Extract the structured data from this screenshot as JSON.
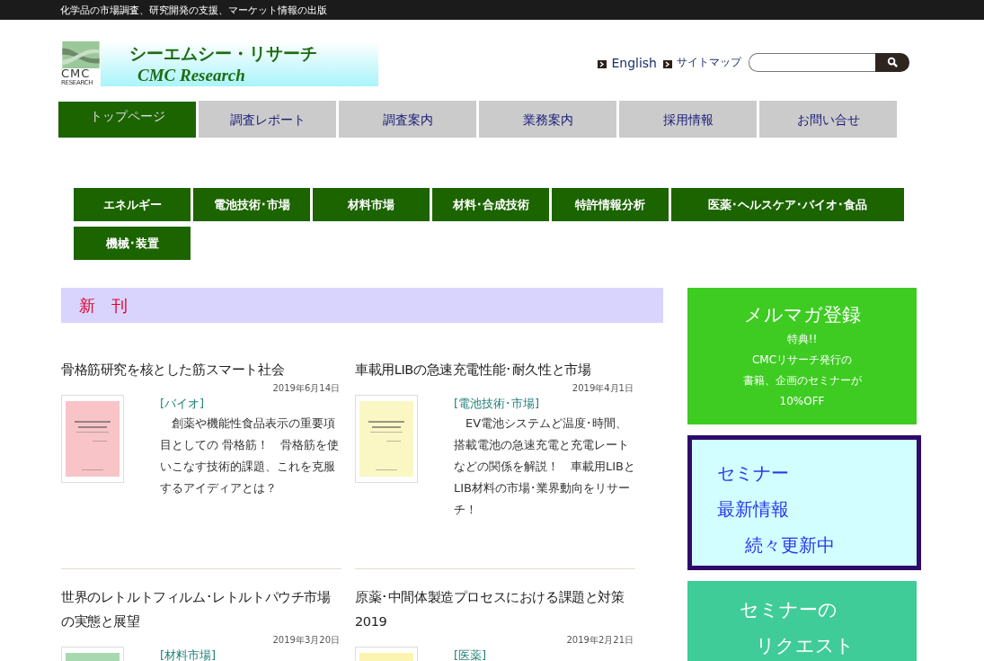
{
  "top_bar": {
    "tagline": "化学品の市場調査、研究開発の支援、マーケット情報の出版"
  },
  "logo": {
    "name_ja": "シーエムシー・リサーチ",
    "name_en": "CMC Research",
    "mark_text": "CMC",
    "mark_sub": "RESEARCH"
  },
  "header_links": [
    "English",
    "サイトマップ"
  ],
  "nav": [
    {
      "label": "トップページ",
      "selected": true
    },
    {
      "label": "調査レポート",
      "selected": false
    },
    {
      "label": "調査案内",
      "selected": false
    },
    {
      "label": "業務案内",
      "selected": false
    },
    {
      "label": "採用情報",
      "selected": false
    },
    {
      "label": "お問い合せ",
      "selected": false
    }
  ],
  "categories": [
    "エネルギー",
    "電池技術･市場",
    "材料市場",
    "材料･合成技術",
    "特許情報分析",
    "医薬･ヘルスケア･バイオ･食品",
    "機械･装置"
  ],
  "section_title": "新　刊",
  "articles": [
    {
      "title": "骨格筋研究を核とした筋スマート社会",
      "date": "2019年6月14日",
      "tag": "[バイオ]",
      "text": "　創薬や機能性食品表示の重要項目としての 骨格筋！　骨格筋を使いこなす技術的課題、これを克服するアイディアとは？",
      "color": "#f8c4c8"
    },
    {
      "title": "車載用LIBの急速充電性能･耐久性と市場",
      "date": "2019年4月1日",
      "tag": "[電池技術･市場]",
      "text": "　EV電池システムど温度･時間、搭載電池の急速充電と充電レートなどの関係を解説！　車載用LIBとLIB材料の市場･業界動向をリサーチ！",
      "color": "#fbf7c4"
    },
    {
      "title": "世界のレトルトフィルム･レトルトパウチ市場の実態と展望",
      "date": "2019年3月20日",
      "tag": "[材料市場]",
      "color": "#a8d8b0"
    },
    {
      "title": "原薬･中間体製造プロセスにおける課題と対策2019",
      "date": "2019年2月21日",
      "tag": "[医薬]",
      "color": "#fbf3b0"
    }
  ],
  "side": {
    "mailmag": {
      "title": "メルマガ登録",
      "lines": [
        "特典!!",
        "CMCリサーチ発行の",
        "書籍、企画のセミナーが",
        "10%OFF"
      ]
    },
    "seminar": {
      "lines": [
        "セミナー",
        "最新情報",
        "続々更新中"
      ]
    },
    "request": {
      "lines": [
        "セミナーの",
        "リクエスト"
      ]
    }
  }
}
